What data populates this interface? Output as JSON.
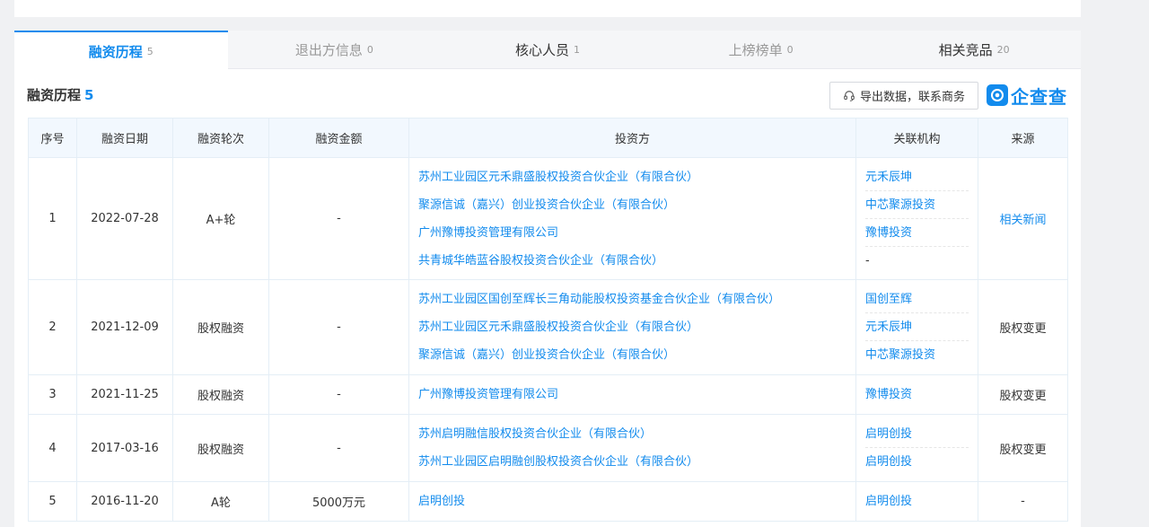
{
  "tabs": [
    {
      "label": "融资历程",
      "count": "5"
    },
    {
      "label": "退出方信息",
      "count": "0"
    },
    {
      "label": "核心人员",
      "count": "1"
    },
    {
      "label": "上榜榜单",
      "count": "0"
    },
    {
      "label": "相关竞品",
      "count": "20"
    }
  ],
  "section": {
    "title": "融资历程",
    "count": "5"
  },
  "export_label": "导出数据，联系商务",
  "brand": "企查查",
  "headers": [
    "序号",
    "融资日期",
    "融资轮次",
    "融资金额",
    "投资方",
    "关联机构",
    "来源"
  ],
  "rows": [
    {
      "idx": "1",
      "date": "2022-07-28",
      "round": "A+轮",
      "amount": "-",
      "investors": [
        "苏州工业园区元禾鼎盛股权投资合伙企业（有限合伙）",
        "聚源信诚（嘉兴）创业投资合伙企业（有限合伙）",
        "广州豫博投资管理有限公司",
        "共青城华皓蓝谷股权投资合伙企业（有限合伙）"
      ],
      "related": [
        "元禾辰坤",
        "中芯聚源投资",
        "豫博投资",
        "-"
      ],
      "source": "相关新闻"
    },
    {
      "idx": "2",
      "date": "2021-12-09",
      "round": "股权融资",
      "amount": "-",
      "investors": [
        "苏州工业园区国创至辉长三角动能股权投资基金合伙企业（有限合伙）",
        "苏州工业园区元禾鼎盛股权投资合伙企业（有限合伙）",
        "聚源信诚（嘉兴）创业投资合伙企业（有限合伙）"
      ],
      "related": [
        "国创至辉",
        "元禾辰坤",
        "中芯聚源投资"
      ],
      "source": "股权变更"
    },
    {
      "idx": "3",
      "date": "2021-11-25",
      "round": "股权融资",
      "amount": "-",
      "investors": [
        "广州豫博投资管理有限公司"
      ],
      "related": [
        "豫博投资"
      ],
      "source": "股权变更"
    },
    {
      "idx": "4",
      "date": "2017-03-16",
      "round": "股权融资",
      "amount": "-",
      "investors": [
        "苏州启明融信股权投资合伙企业（有限合伙）",
        "苏州工业园区启明融创股权投资合伙企业（有限合伙）"
      ],
      "related": [
        "启明创投",
        "启明创投"
      ],
      "source": "股权变更"
    },
    {
      "idx": "5",
      "date": "2016-11-20",
      "round": "A轮",
      "amount": "5000万元",
      "investors": [
        "启明创投"
      ],
      "related": [
        "启明创投"
      ],
      "source": "-"
    }
  ],
  "colors": {
    "accent": "#128bed",
    "header_bg": "#f2f8fe"
  }
}
